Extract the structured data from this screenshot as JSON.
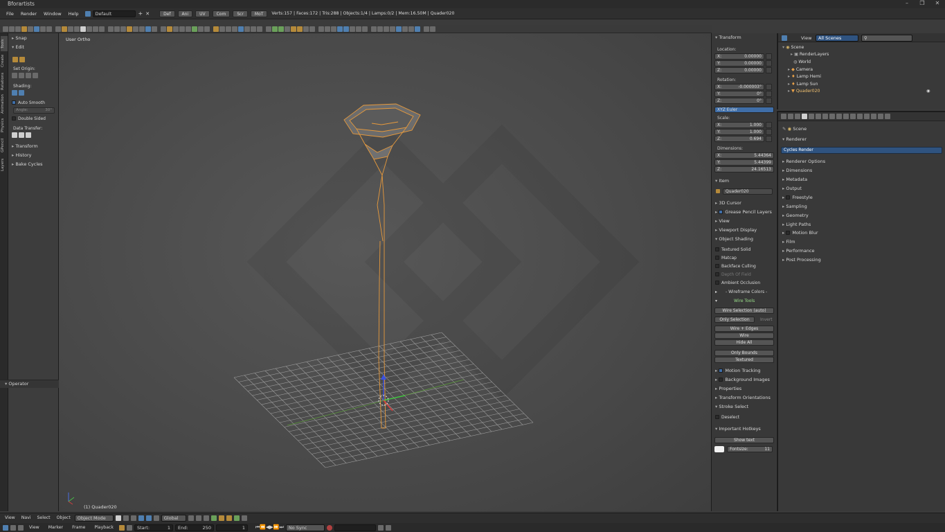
{
  "app": {
    "title": "Bforartists",
    "window_controls": [
      "–",
      "❐",
      "✕"
    ]
  },
  "menubar": {
    "items": [
      "File",
      "Render",
      "Window",
      "Help"
    ],
    "screen_layout": "Default",
    "workspace_tabs": [
      "Def",
      "Ani",
      "UV",
      "Com",
      "Scr",
      "MoT"
    ],
    "stats": "Verts:157 | Faces:172 | Tris:288 | Objects:1/4 | Lamps:0/2 | Mem:16.50M | Quader020"
  },
  "left_tabs": [
    "Tools",
    "Create",
    "Relations",
    "Animation",
    "Physics",
    "GPencil",
    "Layers"
  ],
  "tool_shelf": {
    "snap": "Snap",
    "edit": "Edit",
    "set_origin": "Set Origin:",
    "shading": "Shading:",
    "auto_smooth": "Auto Smooth",
    "angle_label": "Angle:",
    "angle_value": "30°",
    "double_sided": "Double Sided",
    "data_transfer": "Data Transfer:",
    "transform": "Transform",
    "history": "History",
    "bake_cycles": "Bake Cycles",
    "operator": "Operator"
  },
  "viewport": {
    "view_name": "User Ortho",
    "object_label": "(1) Quader020"
  },
  "npanel": {
    "transform": "Transform",
    "location": "Location:",
    "loc": [
      {
        "axis": "X:",
        "value": "0.00000"
      },
      {
        "axis": "Y:",
        "value": "0.00000"
      },
      {
        "axis": "Z:",
        "value": "0.00000"
      }
    ],
    "rotation": "Rotation:",
    "rot": [
      {
        "axis": "X:",
        "value": "-0.000003°"
      },
      {
        "axis": "Y:",
        "value": "0°"
      },
      {
        "axis": "Z:",
        "value": "0°"
      }
    ],
    "rotation_mode": "XYZ Euler",
    "scale": "Scale:",
    "scl": [
      {
        "axis": "X:",
        "value": "1.000"
      },
      {
        "axis": "Y:",
        "value": "1.000"
      },
      {
        "axis": "Z:",
        "value": "0.694"
      }
    ],
    "dimensions": "Dimensions:",
    "dim": [
      {
        "axis": "X:",
        "value": "5.44364"
      },
      {
        "axis": "Y:",
        "value": "5.44399"
      },
      {
        "axis": "Z:",
        "value": "24.16513"
      }
    ],
    "item": "Item",
    "item_name": "Quader020",
    "cursor_3d": "3D Cursor",
    "grease_pencil_layers": "Grease Pencil Layers",
    "view": "View",
    "viewport_display": "Viewport Display",
    "object_shading": "Object Shading",
    "textured_solid": "Textured Solid",
    "matcap": "Matcap",
    "backface_culling": "Backface Culling",
    "depth_of_field": "Depth Of Field",
    "ambient_occlusion": "Ambient Occlusion",
    "wireframe_colors": "- Wireframe Colors -",
    "wire_tools": "Wire Tools",
    "wire_selection": "Wire Selection (auto)",
    "only_selection": "Only Selection",
    "invert": "Invert",
    "wire_edges": "Wire + Edges",
    "wire": "Wire",
    "hide_all": "Hide All",
    "only_bounds": "Only Bounds",
    "textured": "Textured",
    "motion_tracking": "Motion Tracking",
    "background_images": "Background Images",
    "properties": "Properties",
    "transform_orientations": "Transform Orientations",
    "stroke_select": "Stroke Select",
    "deselect": "Deselect",
    "important_hotkeys": "Important Hotkeys",
    "show_text": "Show text",
    "fontsize_label": "Fontsize:",
    "fontsize_value": "11"
  },
  "outliner": {
    "view": "View",
    "scenes": "All Scenes",
    "items": [
      "Scene",
      "RenderLayers",
      "World",
      "Camera",
      "Lamp Hemi",
      "Lamp Sun",
      "Quader020"
    ]
  },
  "properties": {
    "breadcrumb": "Scene",
    "renderer": "Renderer",
    "render_engine": "Cycles Render",
    "sections": [
      "Renderer Options",
      "Dimensions",
      "Metadata",
      "Output",
      "Freestyle",
      "Sampling",
      "Geometry",
      "Light Paths",
      "Motion Blur",
      "Film",
      "Performance",
      "Post Processing"
    ]
  },
  "bottombar": {
    "items": [
      "View",
      "Navi",
      "Select",
      "Object"
    ],
    "mode": "Object Mode",
    "orientation": "Global"
  },
  "timeline": {
    "items": [
      "View",
      "Marker",
      "Frame",
      "Playback"
    ],
    "start_label": "Start:",
    "start_value": "1",
    "end_label": "End:",
    "end_value": "250",
    "current_frame": "1",
    "sync": "No Sync"
  }
}
